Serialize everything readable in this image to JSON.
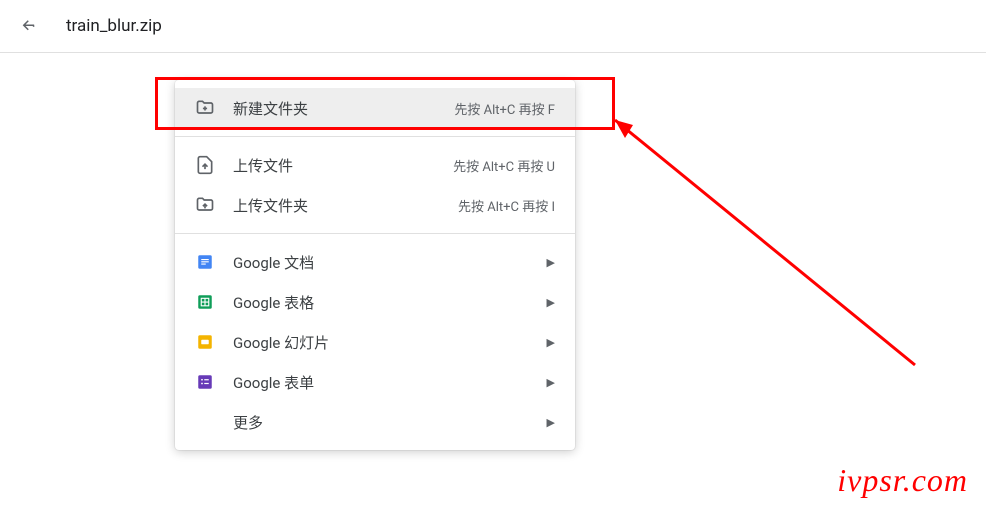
{
  "topbar": {
    "filename": "train_blur.zip"
  },
  "menu": {
    "new_folder": {
      "label": "新建文件夹",
      "shortcut": "先按 Alt+C 再按 F"
    },
    "upload_file": {
      "label": "上传文件",
      "shortcut": "先按 Alt+C 再按 U"
    },
    "upload_folder": {
      "label": "上传文件夹",
      "shortcut": "先按 Alt+C 再按 I"
    },
    "google_docs": {
      "label": "Google 文档"
    },
    "google_sheets": {
      "label": "Google 表格"
    },
    "google_slides": {
      "label": "Google 幻灯片"
    },
    "google_forms": {
      "label": "Google 表单"
    },
    "more": {
      "label": "更多"
    }
  },
  "watermark": "ivpsr.com",
  "colors": {
    "highlight": "#ff0000",
    "docs_blue": "#4285f4",
    "sheets_green": "#34a853",
    "slides_yellow": "#f4b400",
    "forms_purple": "#673ab7",
    "icon_gray": "#5f6368"
  }
}
